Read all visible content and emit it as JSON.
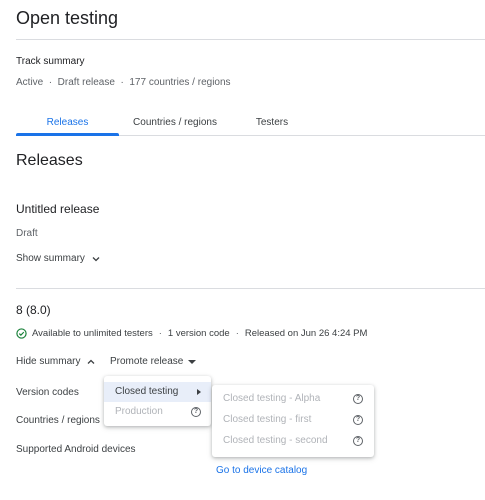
{
  "page": {
    "title": "Open testing"
  },
  "track_summary": {
    "label": "Track summary",
    "line": "Active  ·  Draft release  ·  177 countries / regions"
  },
  "tabs": [
    {
      "label": "Releases",
      "active": true
    },
    {
      "label": "Countries / regions",
      "active": false
    },
    {
      "label": "Testers",
      "active": false
    }
  ],
  "releases": {
    "heading": "Releases",
    "untitled": {
      "title": "Untitled release",
      "status": "Draft",
      "show_summary": "Show summary"
    },
    "version": {
      "title": "8 (8.0)",
      "available": "Available to unlimited testers",
      "codes": "1 version code",
      "released": "Released on Jun 26 4:24 PM",
      "hide_summary": "Hide summary",
      "promote": "Promote release",
      "rows": {
        "version_codes": "Version codes",
        "countries": "Countries / regions",
        "devices": "Supported Android devices"
      },
      "device_catalog_link": "Go to device catalog"
    }
  },
  "promote_menu": {
    "items": [
      {
        "label": "Closed testing",
        "selected": true,
        "submenu": true
      },
      {
        "label": "Production",
        "disabled": true,
        "help": true
      }
    ]
  },
  "closed_testing_submenu": {
    "items": [
      {
        "label": "Closed testing - Alpha",
        "disabled": true
      },
      {
        "label": "Closed testing - first",
        "disabled": true
      },
      {
        "label": "Closed testing - second",
        "disabled": true
      }
    ]
  },
  "colors": {
    "accent": "#1a73e8",
    "success": "#188038",
    "divider": "#dadce0",
    "menu_selected": "#e8eef9"
  }
}
